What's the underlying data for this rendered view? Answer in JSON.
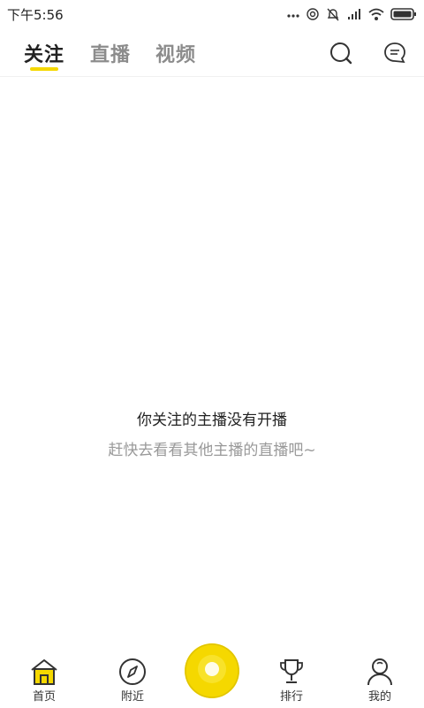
{
  "status_bar": {
    "time": "下午5:56",
    "icons": [
      "more-dots-icon",
      "hotspot-icon",
      "alarm-off-icon",
      "signal-icon",
      "wifi-icon",
      "battery-icon"
    ]
  },
  "header": {
    "tabs": [
      {
        "label": "关注",
        "active": true
      },
      {
        "label": "直播",
        "active": false
      },
      {
        "label": "视频",
        "active": false
      }
    ],
    "actions": [
      "search-icon",
      "message-icon"
    ],
    "accent_color": "#f5d800"
  },
  "empty_state": {
    "title": "你关注的主播没有开播",
    "subtitle": "赶快去看看其他主播的直播吧~"
  },
  "bottom_nav": {
    "items": [
      {
        "label": "首页",
        "icon": "home-icon",
        "active": true
      },
      {
        "label": "附近",
        "icon": "compass-icon",
        "active": false
      },
      {
        "label": "",
        "icon": "go-live-button",
        "active": false
      },
      {
        "label": "排行",
        "icon": "trophy-icon",
        "active": false
      },
      {
        "label": "我的",
        "icon": "profile-icon",
        "active": false
      }
    ]
  }
}
